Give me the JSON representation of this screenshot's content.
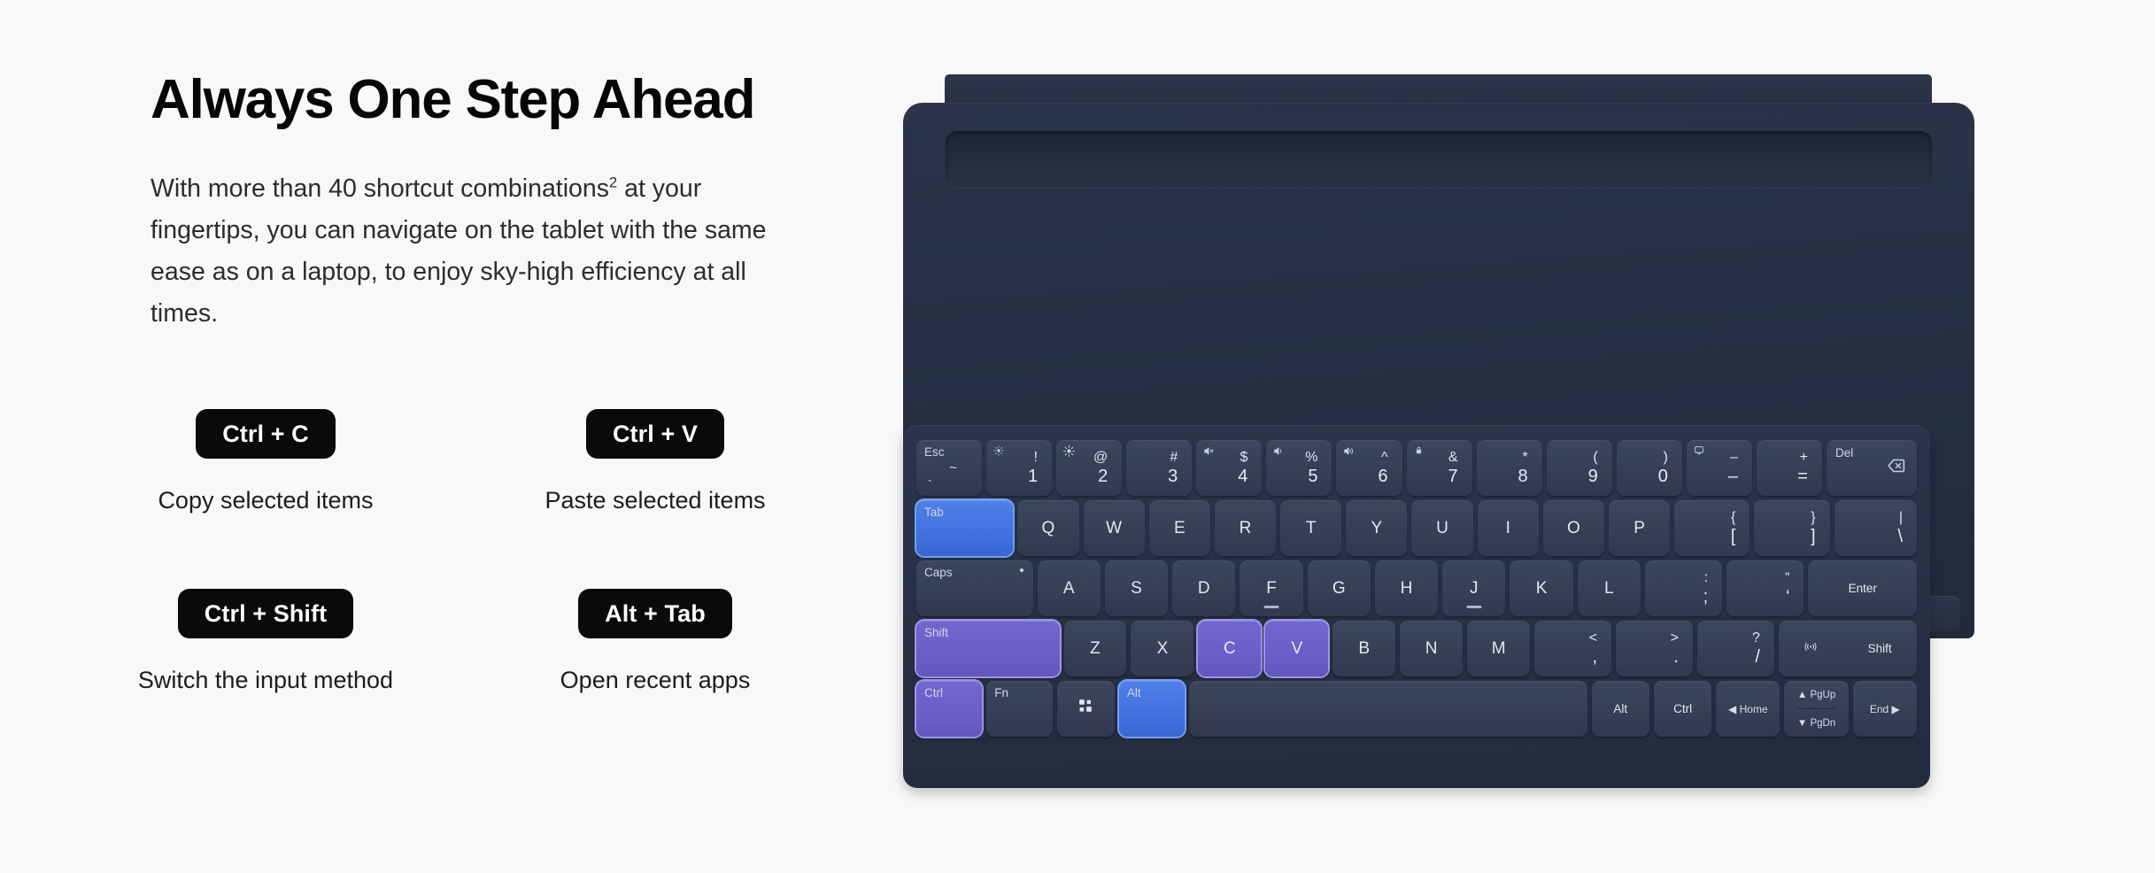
{
  "headline": "Always One Step Ahead",
  "body": {
    "before_sup": "With more than 40 shortcut combinations",
    "sup": "2",
    "after_sup": " at your fingertips, you can navigate on the tablet with the same ease as on a laptop, to enjoy sky-high efficiency at all times."
  },
  "shortcuts": [
    {
      "combo": "Ctrl + C",
      "caption": "Copy selected items"
    },
    {
      "combo": "Ctrl + V",
      "caption": "Paste selected items"
    },
    {
      "combo": "Ctrl + Shift",
      "caption": "Switch the input method"
    },
    {
      "combo": "Alt + Tab",
      "caption": "Open recent apps"
    }
  ],
  "colors": {
    "page_background": "#f8f8f8",
    "chip_background": "#0a0a0a",
    "chip_text": "#ffffff",
    "headline_text": "#060606",
    "body_text": "#2c2c2c",
    "folio_navy": "#283145",
    "keycap": "#39425750",
    "highlight_blue": "#4272de",
    "highlight_purple": "#6a5fc8",
    "key_legend": "#e3e8f2"
  },
  "keyboard": {
    "highlight_legend": {
      "blue": [
        "Tab",
        "Alt"
      ],
      "purple": [
        "Shift",
        "C",
        "V",
        "Ctrl"
      ]
    },
    "row_number": [
      {
        "id": "esc",
        "type": "esc",
        "label": "Esc",
        "top": "~",
        "bottom": "`"
      },
      {
        "id": "1",
        "type": "dual",
        "top": "!",
        "bottom": "1",
        "fn": "brightness-down-icon"
      },
      {
        "id": "2",
        "type": "dual",
        "top": "@",
        "bottom": "2",
        "fn": "brightness-up-icon"
      },
      {
        "id": "3",
        "type": "dual",
        "top": "#",
        "bottom": "3",
        "fn": ""
      },
      {
        "id": "4",
        "type": "dual",
        "top": "$",
        "bottom": "4",
        "fn": "volume-mute-icon"
      },
      {
        "id": "5",
        "type": "dual",
        "top": "%",
        "bottom": "5",
        "fn": "volume-down-icon"
      },
      {
        "id": "6",
        "type": "dual",
        "top": "^",
        "bottom": "6",
        "fn": "volume-up-icon"
      },
      {
        "id": "7",
        "type": "dual",
        "top": "&",
        "bottom": "7",
        "fn": "lock-icon"
      },
      {
        "id": "8",
        "type": "dual",
        "top": "*",
        "bottom": "8",
        "fn": ""
      },
      {
        "id": "9",
        "type": "dual",
        "top": "(",
        "bottom": "9",
        "fn": ""
      },
      {
        "id": "0",
        "type": "dual",
        "top": ")",
        "bottom": "0",
        "fn": ""
      },
      {
        "id": "minus",
        "type": "dual",
        "top": "–",
        "bottom": "–",
        "fn": "screenshot-icon"
      },
      {
        "id": "equal",
        "type": "dual",
        "top": "+",
        "bottom": "=",
        "fn": ""
      },
      {
        "id": "backspace",
        "type": "del",
        "label": "Del",
        "icon": "backspace-icon"
      }
    ],
    "row_top": [
      {
        "id": "tab",
        "type": "corner",
        "label": "Tab",
        "state": "blue"
      },
      {
        "id": "q",
        "type": "letter",
        "label": "Q"
      },
      {
        "id": "w",
        "type": "letter",
        "label": "W"
      },
      {
        "id": "e",
        "type": "letter",
        "label": "E"
      },
      {
        "id": "r",
        "type": "letter",
        "label": "R"
      },
      {
        "id": "t",
        "type": "letter",
        "label": "T"
      },
      {
        "id": "y",
        "type": "letter",
        "label": "Y"
      },
      {
        "id": "u",
        "type": "letter",
        "label": "U"
      },
      {
        "id": "i",
        "type": "letter",
        "label": "I"
      },
      {
        "id": "o",
        "type": "letter",
        "label": "O"
      },
      {
        "id": "p",
        "type": "letter",
        "label": "P"
      },
      {
        "id": "bracket-left",
        "type": "dual",
        "top": "{",
        "bottom": "["
      },
      {
        "id": "bracket-right",
        "type": "dual",
        "top": "}",
        "bottom": "]"
      },
      {
        "id": "backslash",
        "type": "dual",
        "top": "|",
        "bottom": "\\"
      }
    ],
    "row_home": [
      {
        "id": "caps",
        "type": "corner",
        "label": "Caps",
        "led": true
      },
      {
        "id": "a",
        "type": "letter",
        "label": "A"
      },
      {
        "id": "s",
        "type": "letter",
        "label": "S"
      },
      {
        "id": "d",
        "type": "letter",
        "label": "D"
      },
      {
        "id": "f",
        "type": "letter",
        "label": "F",
        "homing": true
      },
      {
        "id": "g",
        "type": "letter",
        "label": "G"
      },
      {
        "id": "h",
        "type": "letter",
        "label": "H"
      },
      {
        "id": "j",
        "type": "letter",
        "label": "J",
        "homing": true
      },
      {
        "id": "k",
        "type": "letter",
        "label": "K"
      },
      {
        "id": "l",
        "type": "letter",
        "label": "L"
      },
      {
        "id": "semicolon",
        "type": "dual",
        "top": ":",
        "bottom": ";"
      },
      {
        "id": "quote",
        "type": "dual",
        "top": "“",
        "bottom": "‘"
      },
      {
        "id": "enter",
        "type": "center-small",
        "label": "Enter"
      }
    ],
    "row_bottom": [
      {
        "id": "shift-left",
        "type": "corner",
        "label": "Shift",
        "state": "purple"
      },
      {
        "id": "z",
        "type": "letter",
        "label": "Z"
      },
      {
        "id": "x",
        "type": "letter",
        "label": "X"
      },
      {
        "id": "c",
        "type": "letter",
        "label": "C",
        "state": "purple"
      },
      {
        "id": "v",
        "type": "letter",
        "label": "V",
        "state": "purple"
      },
      {
        "id": "b",
        "type": "letter",
        "label": "B"
      },
      {
        "id": "n",
        "type": "letter",
        "label": "N"
      },
      {
        "id": "m",
        "type": "letter",
        "label": "M"
      },
      {
        "id": "comma",
        "type": "dual",
        "top": "<",
        "bottom": ","
      },
      {
        "id": "period",
        "type": "dual",
        "top": ">",
        "bottom": "."
      },
      {
        "id": "slash",
        "type": "dual",
        "top": "?",
        "bottom": "/"
      },
      {
        "id": "shift-right",
        "type": "shift-right",
        "label": "Shift",
        "icon": "wireless-icon"
      }
    ],
    "row_modifier": [
      {
        "id": "ctrl-left",
        "type": "corner",
        "label": "Ctrl",
        "state": "purple"
      },
      {
        "id": "fn",
        "type": "corner",
        "label": "Fn"
      },
      {
        "id": "apps",
        "type": "icon",
        "icon": "app-grid-icon"
      },
      {
        "id": "alt-left",
        "type": "corner",
        "label": "Alt",
        "state": "blue"
      },
      {
        "id": "space",
        "type": "space",
        "label": ""
      },
      {
        "id": "alt-right",
        "type": "center-small",
        "label": "Alt"
      },
      {
        "id": "ctrl-right",
        "type": "center-small",
        "label": "Ctrl"
      },
      {
        "id": "home",
        "type": "nav",
        "label": "Home",
        "arrow": "◀",
        "arrow_side": "left"
      },
      {
        "id": "pg",
        "type": "stack",
        "top_label": "PgUp",
        "top_arrow": "▲",
        "bottom_label": "PgDn",
        "bottom_arrow": "▼"
      },
      {
        "id": "end",
        "type": "nav",
        "label": "End",
        "arrow": "▶",
        "arrow_side": "right"
      }
    ]
  }
}
